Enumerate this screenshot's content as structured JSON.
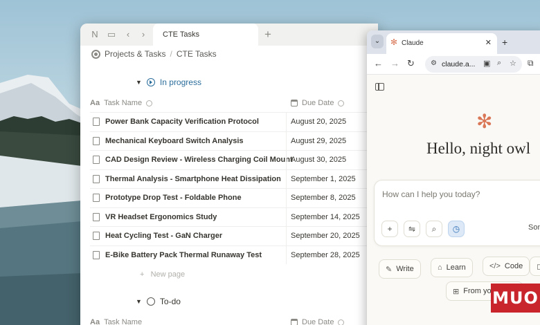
{
  "notion": {
    "tab_title": "CTE Tasks",
    "breadcrumb": [
      "Projects & Tasks",
      "CTE Tasks"
    ],
    "breadcrumb_sep": "/",
    "groups": [
      {
        "label": "In progress"
      },
      {
        "label": "To-do"
      }
    ],
    "columns": {
      "name": "Task Name",
      "date": "Due Date"
    },
    "name_prop_icon": "Aa",
    "tasks": [
      {
        "name": "Power Bank Capacity Verification Protocol",
        "due": "August 20, 2025"
      },
      {
        "name": "Mechanical Keyboard Switch Analysis",
        "due": "August 29, 2025"
      },
      {
        "name": "CAD Design Review - Wireless Charging Coil Mount",
        "due": "August 30, 2025"
      },
      {
        "name": "Thermal Analysis - Smartphone Heat Dissipation",
        "due": "September 1, 2025"
      },
      {
        "name": "Prototype Drop Test - Foldable Phone",
        "due": "September 8, 2025"
      },
      {
        "name": "VR Headset Ergonomics Study",
        "due": "September 14, 2025"
      },
      {
        "name": "Heat Cycling Test - GaN Charger",
        "due": "September 20, 2025"
      },
      {
        "name": "E-Bike Battery Pack Thermal Runaway Test",
        "due": "September 28, 2025"
      }
    ],
    "new_page": "New page"
  },
  "browser": {
    "tab_title": "Claude",
    "url": "claude.a...",
    "greeting": "Hello, night owl",
    "composer_placeholder": "How can I help you today?",
    "model_label": "Sonr",
    "chips": [
      "Write",
      "Learn",
      "Code",
      "From your apps"
    ]
  },
  "watermark": "MUO",
  "colors": {
    "accent_blue": "#2a6d9b",
    "claude_orange": "#d97757",
    "watermark_red": "#c8262c"
  }
}
